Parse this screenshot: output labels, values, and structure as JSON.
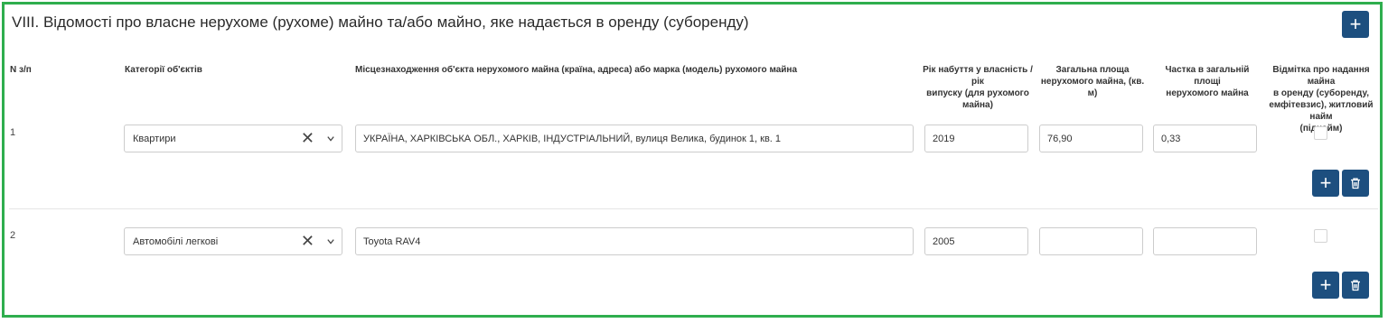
{
  "section": {
    "title": "VIII. Відомості про власне нерухоме (рухоме) майно та/або майно, яке надається в оренду (суборенду)",
    "add_icon": "plus-icon"
  },
  "headers": {
    "num": "N з/п",
    "category": "Категорії об'єктів",
    "location": "Місцезнаходження об'єкта нерухомого майна (країна, адреса) або марка (модель) рухомого майна",
    "year": [
      "Рік набуття у власність / рік",
      "випуску (для рухомого",
      "майна)"
    ],
    "area": [
      "Загальна площа",
      "нерухомого майна, (кв. м)"
    ],
    "share": [
      "Частка в загальній площі",
      "нерухомого майна"
    ],
    "rent": [
      "Відмітка про надання майна",
      "в оренду (суборенду,",
      "емфітевзис), житловий найм",
      "(піднайм)"
    ]
  },
  "rows": [
    {
      "num": "1",
      "category": "Квартири",
      "location": "УКРАЇНА, ХАРКІВСЬКА ОБЛ., ХАРКІВ, ІНДУСТРІАЛЬНИЙ, вулиця Велика, будинок 1, кв. 1",
      "year": "2019",
      "area": "76,90",
      "share": "0,33",
      "rent_checked": false
    },
    {
      "num": "2",
      "category": "Автомобілі легкові",
      "location": "Toyota RAV4",
      "year": "2005",
      "area": "",
      "share": "",
      "rent_checked": false
    }
  ],
  "icons": {
    "clear": "close-icon",
    "dropdown": "chevron-down-icon",
    "add": "plus-icon",
    "delete": "trash-icon"
  },
  "colors": {
    "border": "#2fae4e",
    "button": "#1d4f7f"
  }
}
